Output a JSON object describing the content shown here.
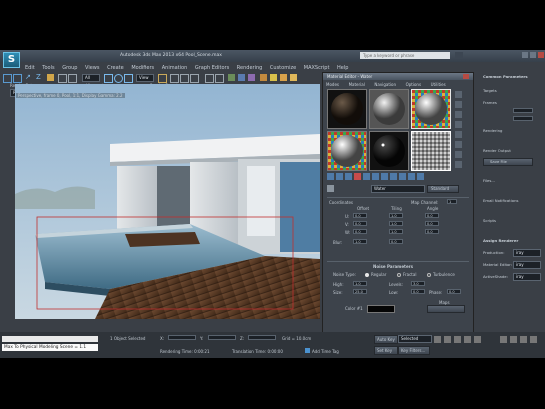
{
  "title_bar": {
    "caption": "Autodesk 3ds Max 2013 x64    Pool_Scene.max",
    "search_placeholder": "Type a keyword or phrase"
  },
  "menu": [
    "Edit",
    "Tools",
    "Group",
    "Views",
    "Create",
    "Modifiers",
    "Animation",
    "Graph Editors",
    "Rendering",
    "Customize",
    "MAXScript",
    "Help"
  ],
  "toolbar_row2": {
    "render_setup_label": "Render Setup",
    "viewport_label": "Viewport",
    "render_preset_label": "Render Preset",
    "render_setup_value": "Region",
    "viewport_value": "Perspective",
    "preset_value": "",
    "renderer_value": "iray Active"
  },
  "viewport": {
    "label": "Perspective, frame 0, Pool, 1:1, Display Gamma: 2.2"
  },
  "material_editor": {
    "title": "Material Editor - Water",
    "menu": [
      "Modes",
      "Material",
      "Navigation",
      "Options",
      "Utilities"
    ],
    "material_name": "Water",
    "material_type": "Standard",
    "coords_label": "Coordinates",
    "tiling_label": "Tiling",
    "offset_label": "Offset",
    "angle_label": "Angle",
    "u_label": "U:",
    "v_label": "V:",
    "w_label": "W:",
    "blur_label": "Blur:",
    "map_channel_label": "Map Channel:",
    "noise_rollout": "Noise Parameters",
    "noise_type_label": "Noise Type:",
    "noise_types": [
      "Regular",
      "Fractal",
      "Turbulence"
    ],
    "size_label": "Size:",
    "high_label": "High:",
    "low_label": "Low:",
    "levels_label": "Levels:",
    "phase_label": "Phase:",
    "color1_label": "Color #1",
    "maps_label": "Maps",
    "values": {
      "offset_u": "0.0",
      "offset_v": "0.0",
      "offset_w": "0.0",
      "tiling_u": "1.0",
      "tiling_v": "1.0",
      "tiling_w": "1.0",
      "angle_u": "0.0",
      "angle_v": "0.0",
      "angle_w": "0.0",
      "blur": "1.0",
      "blur_offset": "0.0",
      "size": "25.0",
      "high": "1.0",
      "low": "0.0",
      "levels": "3.0",
      "phase": "0.0",
      "map_channel": "1"
    }
  },
  "right_panel": {
    "header": "Common Parameters",
    "items": [
      "Targets",
      "Frames",
      "Rendering",
      "Render Output",
      "Save File",
      "Files...",
      "Email Notifications",
      "Scripts",
      "Assign Renderer",
      "Production:",
      "Material Editor:",
      "ActiveShade:"
    ],
    "values": [
      "",
      "",
      "",
      "",
      "",
      "",
      "",
      "",
      "",
      "iray",
      "iray",
      "iray"
    ]
  },
  "status": {
    "maxscript": "Max To Physical Modeling Scene = 1.1",
    "selection": "1 Object Selected",
    "rendering_time": "Rendering Time: 0:00:21",
    "x_label": "X:",
    "y_label": "Y:",
    "z_label": "Z:",
    "grid": "Grid = 10.0cm",
    "auto_key": "Auto Key",
    "selected": "Selected",
    "set_key": "Set Key",
    "key_filters": "Key Filters...",
    "add_time_tag": "Add Time Tag",
    "translation_time": "Translation Time: 0:00:00"
  },
  "colors": {
    "accent": "#2f8fb7",
    "wood": "#5a3a24",
    "water": "#5f8fa8",
    "sky": "#8eafcc"
  }
}
